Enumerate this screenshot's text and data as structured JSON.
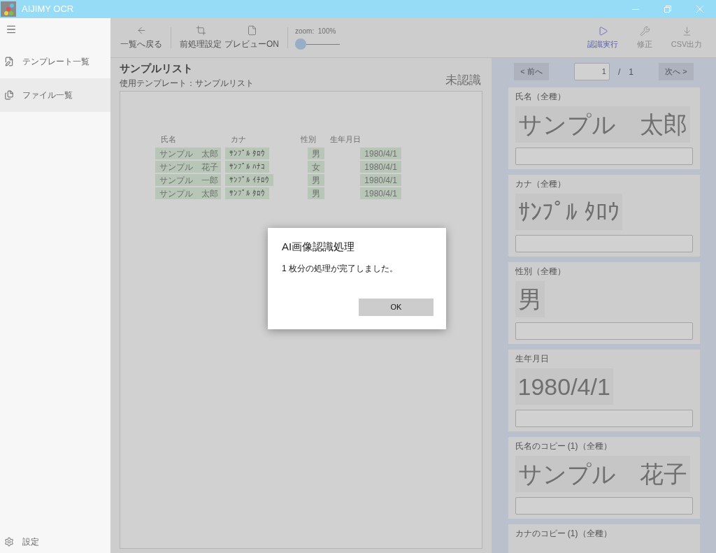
{
  "window": {
    "title": "AIJIMY OCR"
  },
  "sidebar": {
    "items": [
      {
        "label": "テンプレート一覧",
        "kind": "template",
        "selected": false
      },
      {
        "label": "ファイル一覧",
        "kind": "files",
        "selected": true
      }
    ],
    "settings": "設定"
  },
  "toolbar": {
    "left": [
      {
        "label": "一覧へ戻る",
        "kind": "back"
      },
      {
        "label": "前処理設定",
        "kind": "crop"
      },
      {
        "label": "プレビューON",
        "kind": "file"
      }
    ],
    "zoom": {
      "label": "zoom:  100%",
      "level": 0
    },
    "right": [
      {
        "label": "認識実行",
        "kind": "run",
        "disabled": false
      },
      {
        "label": "修正",
        "kind": "edit",
        "disabled": true
      },
      {
        "label": "CSV出力",
        "kind": "export",
        "disabled": true
      }
    ]
  },
  "document": {
    "title": "サンプルリスト",
    "template": "使用テンプレート：サンプルリスト",
    "status": "未認識",
    "columns": [
      "氏名",
      "カナ",
      "性別",
      "生年月日"
    ],
    "rows": [
      [
        "サンプル　太郎",
        "ｻﾝﾌﾟﾙ ﾀﾛｳ",
        "男",
        "1980/4/1"
      ],
      [
        "サンプル　花子",
        "ｻﾝﾌﾟﾙ ﾊﾅｺ",
        "女",
        "1980/4/1"
      ],
      [
        "サンプル　一郎",
        "ｻﾝﾌﾟﾙ ｲﾁﾛｳ",
        "男",
        "1980/4/1"
      ],
      [
        "サンプル　太郎",
        "ｻﾝﾌﾟﾙ ﾀﾛｳ",
        "男",
        "1980/4/1"
      ]
    ]
  },
  "pager": {
    "prev": "< 前へ",
    "page": "1",
    "separator": "/",
    "total": "1",
    "next": "次へ >"
  },
  "fields": [
    {
      "label": "氏名（全種）",
      "image_text": "サンプル　太郎"
    },
    {
      "label": "カナ（全種）",
      "image_text": "ｻﾝﾌﾟﾙ ﾀﾛｳ"
    },
    {
      "label": "性別（全種）",
      "image_text": "男"
    },
    {
      "label": "生年月日",
      "image_text": "1980/4/1"
    },
    {
      "label": "氏名のコピー (1)（全種）",
      "image_text": "サンプル　花子"
    },
    {
      "label": "カナのコピー (1)（全種）"
    }
  ],
  "dialog": {
    "title": "AI画像認識処理",
    "message": "1 枚分の処理が完了しました。",
    "button": "OK"
  }
}
